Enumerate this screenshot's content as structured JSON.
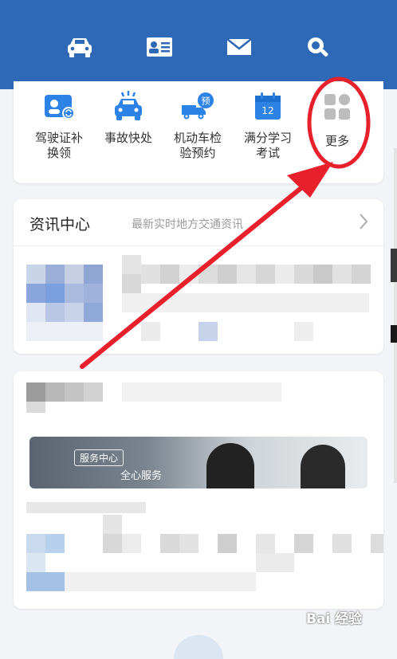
{
  "colors": {
    "brand": "#2d69b6",
    "accent_red": "#e8202c",
    "text": "#333333"
  },
  "top_nav": [
    {
      "icon": "car-icon"
    },
    {
      "icon": "id-card-icon"
    },
    {
      "icon": "mail-icon"
    },
    {
      "icon": "search-icon"
    }
  ],
  "services": [
    {
      "label": "驾驶证补\n换领",
      "icon": "license-renew-icon"
    },
    {
      "label": "事故快处",
      "icon": "accident-car-icon"
    },
    {
      "label": "机动车检\n验预约",
      "icon": "truck-appointment-icon"
    },
    {
      "label": "满分学习\n考试",
      "icon": "calendar-exam-icon",
      "badge": "12"
    },
    {
      "label": "更多",
      "icon": "more-grid-icon"
    }
  ],
  "news": {
    "title": "资讯中心",
    "subtitle": "最新实时地方交通资讯"
  },
  "banner": {
    "tag": "服务中心",
    "caption": "全心服务"
  },
  "watermark": "Bai 经验"
}
